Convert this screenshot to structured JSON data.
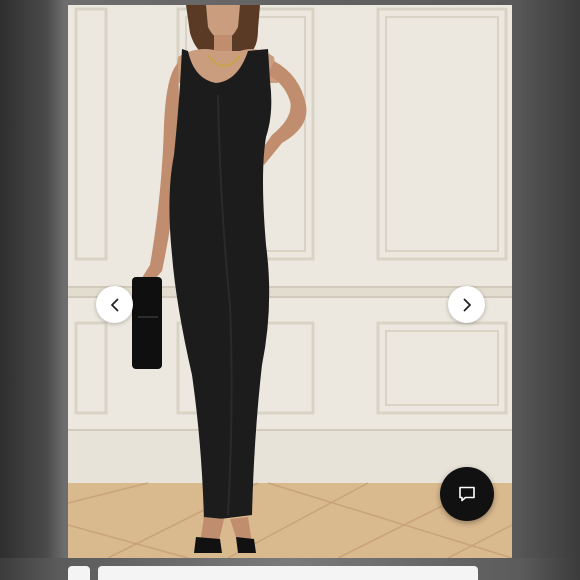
{
  "viewer": {
    "image_subject": "model-in-black-maxi-dress-photo",
    "prev_icon": "chevron-left-icon",
    "next_icon": "chevron-right-icon"
  },
  "chat": {
    "icon": "chat-bubble-icon"
  },
  "colors": {
    "wall": "#ece8df",
    "dress": "#1c1c1c",
    "floor": "#d9b98e",
    "chat_button": "#111111",
    "nav_button": "#ffffff"
  }
}
